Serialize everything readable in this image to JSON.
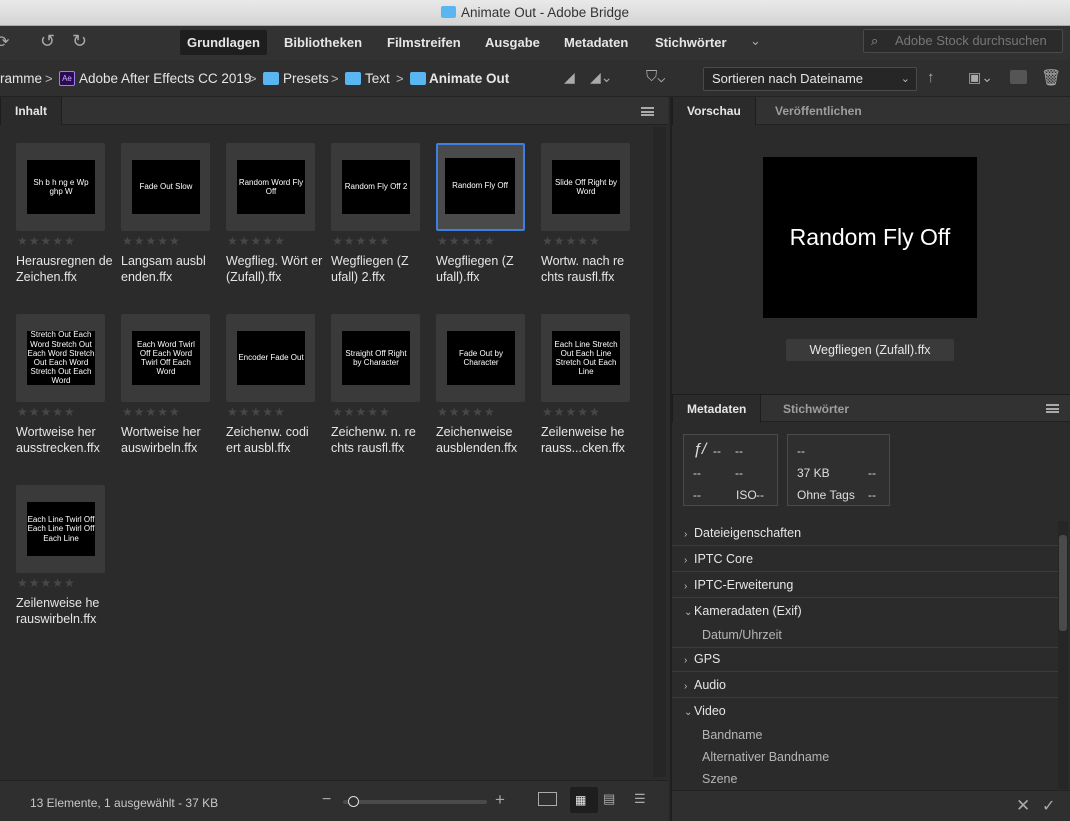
{
  "window": {
    "title": "Animate Out - Adobe Bridge"
  },
  "workspaces": [
    "Grundlagen",
    "Bibliotheken",
    "Filmstreifen",
    "Ausgabe",
    "Metadaten",
    "Stichwörter"
  ],
  "search": {
    "placeholder": "Adobe Stock durchsuchen"
  },
  "breadcrumb": {
    "items": [
      "ramme",
      "Adobe After Effects CC 2019",
      "Presets",
      "Text",
      "Animate Out"
    ],
    "app_badge": "Ae"
  },
  "sort": {
    "label": "Sortieren nach Dateiname"
  },
  "content": {
    "tab": "Inhalt",
    "items": [
      {
        "name": "Herausregnen de Zeichen.ffx",
        "thumb": "Sh b h ng e Wp ghp W",
        "selected": false
      },
      {
        "name": "Langsam ausbl enden.ffx",
        "thumb": "Fade Out Slow",
        "selected": false
      },
      {
        "name": "Wegflieg. Wört er (Zufall).ffx",
        "thumb": "Random Word Fly Off",
        "selected": false
      },
      {
        "name": "Wegfliegen (Z ufall) 2.ffx",
        "thumb": "Random Fly Off 2",
        "selected": false
      },
      {
        "name": "Wegfliegen (Z ufall).ffx",
        "thumb": "Random Fly Off",
        "selected": true
      },
      {
        "name": "Wortw. nach re chts rausfl.ffx",
        "thumb": "Slide Off Right by Word",
        "selected": false
      },
      {
        "name": "Wortweise her ausstrecken.ffx",
        "thumb": "Stretch Out Each Word Stretch Out Each Word Stretch Out Each Word Stretch Out Each Word",
        "selected": false
      },
      {
        "name": "Wortweise her auswirbeln.ffx",
        "thumb": "Each Word Twirl Off Each Word Twirl Off Each Word",
        "selected": false
      },
      {
        "name": "Zeichenw. codi ert ausbl.ffx",
        "thumb": "Encoder Fade Out",
        "selected": false
      },
      {
        "name": "Zeichenw. n. re chts rausfl.ffx",
        "thumb": "Straight Off Right by Character",
        "selected": false
      },
      {
        "name": "Zeichenweise ausblenden.ffx",
        "thumb": "Fade Out by Character",
        "selected": false
      },
      {
        "name": "Zeilenweise he rauss...cken.ffx",
        "thumb": "Each Line Stretch Out Each Line Stretch Out Each Line",
        "selected": false
      },
      {
        "name": "Zeilenweise he rauswirbeln.ffx",
        "thumb": "Each Line Twirl Off Each Line Twirl Off Each Line",
        "selected": false
      }
    ],
    "status": "13 Elemente, 1 ausgewählt - 37 KB"
  },
  "preview": {
    "tabs": [
      "Vorschau",
      "Veröffentlichen"
    ],
    "image_text": "Random Fly Off",
    "filename": "Wegfliegen (Zufall).ffx"
  },
  "metadata": {
    "tabs": [
      "Metadaten",
      "Stichwörter"
    ],
    "box1": {
      "f": "ƒ/",
      "v1": "--",
      "v2": "--",
      "v3": "--",
      "v4": "--",
      "v5": "--",
      "iso": "ISO",
      "v6": "--"
    },
    "box2": {
      "v1": "--",
      "size": "37 KB",
      "v2": "--",
      "tags": "Ohne Tags",
      "v3": "--"
    },
    "sections": [
      {
        "label": "Dateieigenschaften",
        "open": false
      },
      {
        "label": "IPTC Core",
        "open": false
      },
      {
        "label": "IPTC-Erweiterung",
        "open": false
      },
      {
        "label": "Kameradaten (Exif)",
        "open": true
      },
      {
        "label": "GPS",
        "open": false
      },
      {
        "label": "Audio",
        "open": false
      },
      {
        "label": "Video",
        "open": true
      }
    ],
    "exif_fields": [
      "Datum/Uhrzeit"
    ],
    "video_fields": [
      "Bandname",
      "Alternativer Bandname",
      "Szene"
    ]
  }
}
